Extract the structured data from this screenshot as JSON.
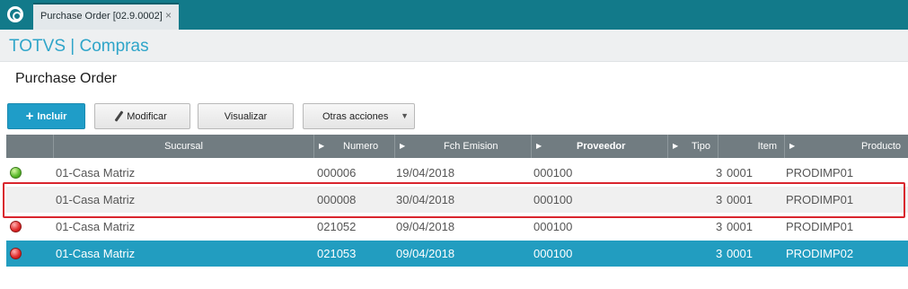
{
  "topbar": {
    "tab_title": "Purchase Order [02.9.0002]",
    "close_glyph": "×"
  },
  "header": {
    "brand": "TOTVS | Compras"
  },
  "page": {
    "title": "Purchase Order"
  },
  "toolbar": {
    "incluir_label": "Incluir",
    "modificar_label": "Modificar",
    "visualizar_label": "Visualizar",
    "otras_label": "Otras acciones",
    "incluir_icon": "plus-icon",
    "modificar_icon": "pencil-icon",
    "otras_icon": "caret-down-icon"
  },
  "table": {
    "columns": {
      "sucursal": "Sucursal",
      "numero": "Numero",
      "fch_emision": "Fch Emision",
      "proveedor": "Proveedor",
      "tipo": "Tipo",
      "item": "Item",
      "producto": "Producto"
    },
    "rows": [
      {
        "status": "green",
        "sucursal": "01-Casa Matriz",
        "numero": "000006",
        "fch_emision": "19/04/2018",
        "proveedor": "000100",
        "tipo": "3",
        "item": "0001",
        "producto": "PRODIMP01"
      },
      {
        "status": "none",
        "sucursal": "01-Casa Matriz",
        "numero": "000008",
        "fch_emision": "30/04/2018",
        "proveedor": "000100",
        "tipo": "3",
        "item": "0001",
        "producto": "PRODIMP01"
      },
      {
        "status": "red",
        "sucursal": "01-Casa Matriz",
        "numero": "021052",
        "fch_emision": "09/04/2018",
        "proveedor": "000100",
        "tipo": "3",
        "item": "0001",
        "producto": "PRODIMP01"
      },
      {
        "status": "red",
        "sucursal": "01-Casa Matriz",
        "numero": "021053",
        "fch_emision": "09/04/2018",
        "proveedor": "000100",
        "tipo": "3",
        "item": "0001",
        "producto": "PRODIMP02"
      }
    ]
  },
  "colors": {
    "topbar": "#127a8a",
    "brand": "#2fa5c9",
    "primary_button": "#1f9dc8",
    "header_row": "#717c81",
    "selected_row": "#229dc0",
    "highlight": "#d9252d",
    "status_green": "#58b82a",
    "status_red": "#e02828"
  }
}
